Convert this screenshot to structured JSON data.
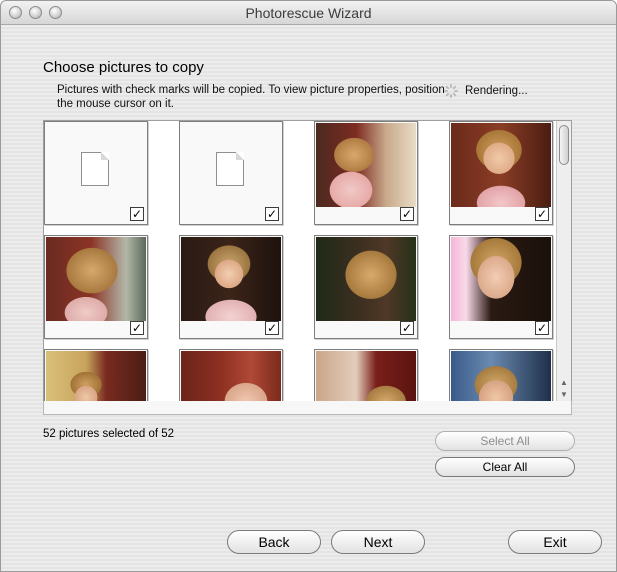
{
  "window": {
    "title": "Photorescue Wizard"
  },
  "page": {
    "heading": "Choose pictures to copy",
    "instructions": "Pictures with check marks will be copied.  To view picture properties, position the mouse cursor on it.",
    "rendering": "Rendering..."
  },
  "thumbnails": [
    {
      "kind": "document",
      "checked": true
    },
    {
      "kind": "document",
      "checked": true
    },
    {
      "kind": "photo",
      "checked": true
    },
    {
      "kind": "photo",
      "checked": true
    },
    {
      "kind": "photo",
      "checked": true
    },
    {
      "kind": "photo",
      "checked": true
    },
    {
      "kind": "photo",
      "checked": true
    },
    {
      "kind": "photo",
      "checked": true
    },
    {
      "kind": "photo",
      "checked": false
    },
    {
      "kind": "photo",
      "checked": false
    },
    {
      "kind": "photo",
      "checked": false
    },
    {
      "kind": "photo",
      "checked": false
    }
  ],
  "check_mark": "✓",
  "status": {
    "selected_text": "52 pictures selected of 52"
  },
  "buttons": {
    "select_all": "Select All",
    "clear_all": "Clear All",
    "back": "Back",
    "next": "Next",
    "exit": "Exit"
  }
}
